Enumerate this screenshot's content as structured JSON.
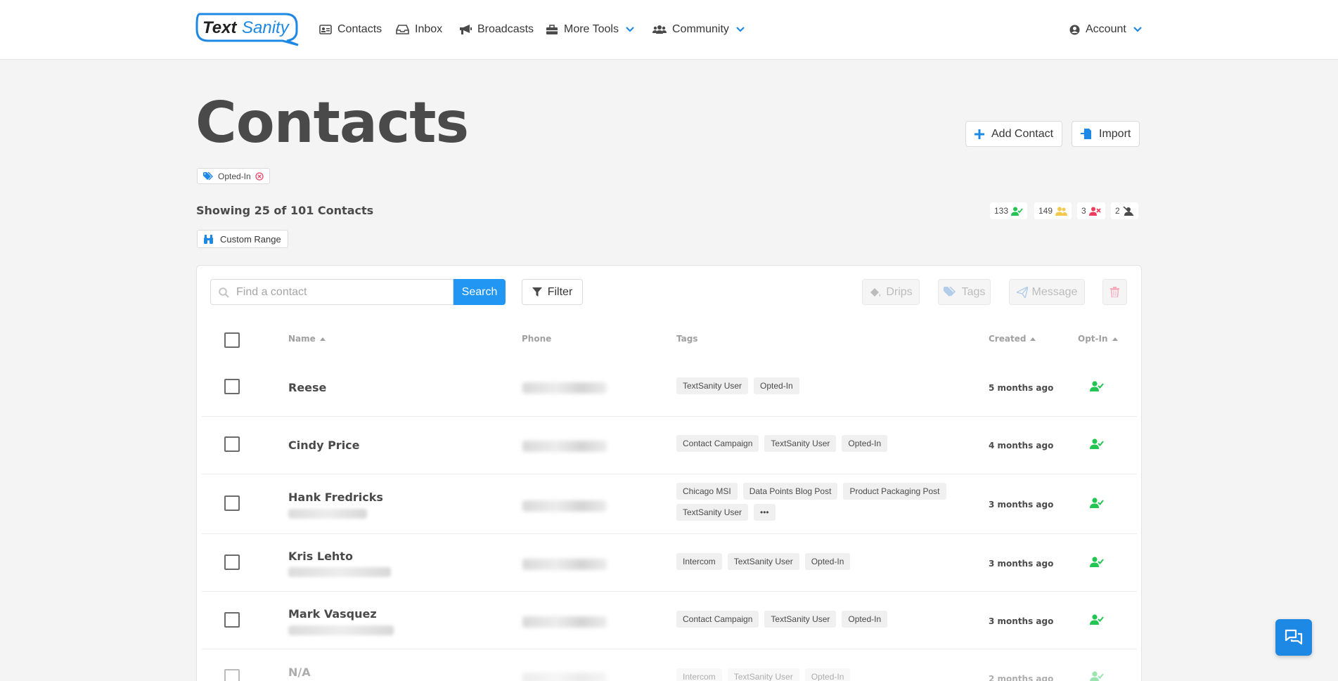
{
  "brand": {
    "logo_text_1": "Text",
    "logo_text_2": "Sanity"
  },
  "nav": {
    "contacts": "Contacts",
    "inbox": "Inbox",
    "broadcasts": "Broadcasts",
    "more_tools": "More Tools",
    "community": "Community",
    "account": "Account"
  },
  "page": {
    "title": "Contacts",
    "add_contact": "Add Contact",
    "import": "Import",
    "active_filter": "Opted-In",
    "showing": "Showing 25 of 101 Contacts",
    "custom_range": "Custom Range"
  },
  "stats": [
    {
      "value": "133",
      "icon": "user-check-icon",
      "color": "#23c552"
    },
    {
      "value": "149",
      "icon": "users-icon",
      "color": "#f2c94c"
    },
    {
      "value": "3",
      "icon": "user-times-icon",
      "color": "#f03e5e"
    },
    {
      "value": "2",
      "icon": "muted-icon",
      "color": "#4a4a4a"
    }
  ],
  "toolbar": {
    "search_placeholder": "Find a contact",
    "search_label": "Search",
    "filter_label": "Filter",
    "drips_label": "Drips",
    "tags_label": "Tags",
    "message_label": "Message"
  },
  "table": {
    "columns": {
      "name": "Name",
      "phone": "Phone",
      "tags": "Tags",
      "created": "Created",
      "optin": "Opt-In"
    },
    "rows": [
      {
        "name": "Reese",
        "tags": [
          "TextSanity User",
          "Opted-In"
        ],
        "created": "5 months ago"
      },
      {
        "name": "Cindy Price",
        "tags": [
          "Contact Campaign",
          "TextSanity User",
          "Opted-In"
        ],
        "created": "4 months ago"
      },
      {
        "name": "Hank Fredricks",
        "tags": [
          "Chicago MSI",
          "Data Points Blog Post",
          "Product Packaging Post",
          "TextSanity User",
          "•••"
        ],
        "created": "3 months ago"
      },
      {
        "name": "Kris Lehto",
        "tags": [
          "Intercom",
          "TextSanity User",
          "Opted-In"
        ],
        "created": "3 months ago"
      },
      {
        "name": "Mark Vasquez",
        "tags": [
          "Contact Campaign",
          "TextSanity User",
          "Opted-In"
        ],
        "created": "3 months ago"
      },
      {
        "name": "N/A",
        "tags": [
          "Intercom",
          "TextSanity User",
          "Opted-In"
        ],
        "created": "2 months ago"
      }
    ]
  },
  "colors": {
    "accent": "#2196f3",
    "optin_green": "#23c552",
    "danger": "#f14668"
  }
}
